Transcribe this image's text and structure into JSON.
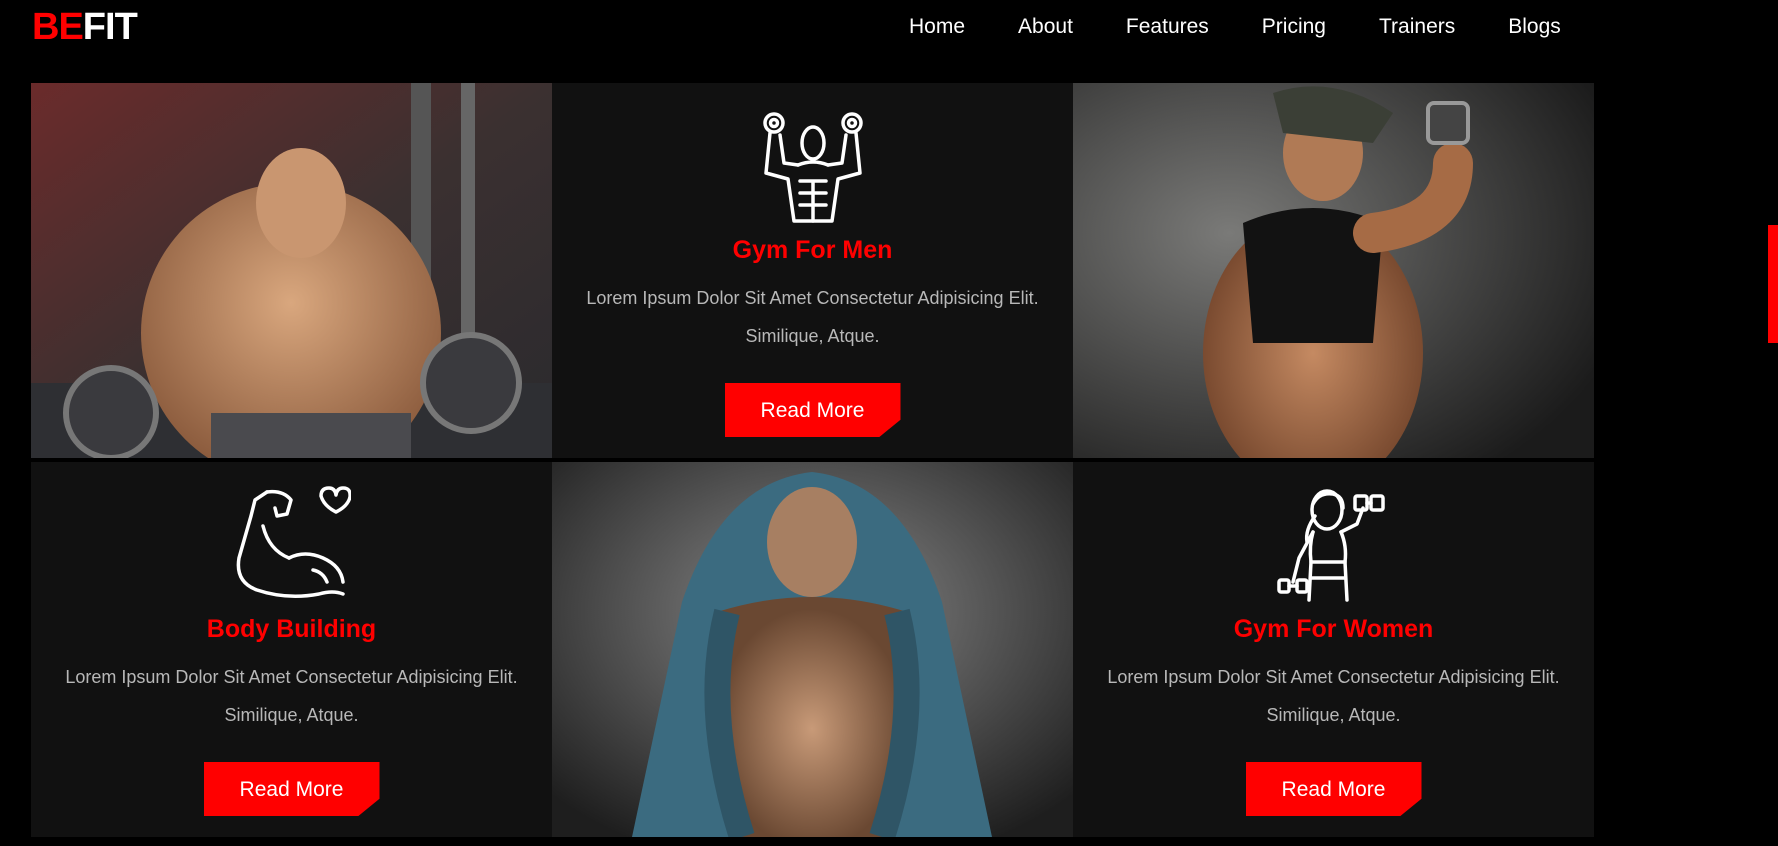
{
  "logo": {
    "part1": "BE",
    "part2": "FIT"
  },
  "nav": {
    "items": [
      {
        "label": "Home"
      },
      {
        "label": "About"
      },
      {
        "label": "Features"
      },
      {
        "label": "Pricing"
      },
      {
        "label": "Trainers"
      },
      {
        "label": "Blogs"
      }
    ]
  },
  "cards": {
    "gym_men": {
      "icon": "bodybuilder-dumbbells-icon",
      "title": "Gym For Men",
      "description": "Lorem Ipsum Dolor Sit Amet Consectetur Adipisicing Elit. Similique, Atque.",
      "button": "Read More"
    },
    "body_building": {
      "icon": "flexed-bicep-heart-icon",
      "title": "Body Building",
      "description": "Lorem Ipsum Dolor Sit Amet Consectetur Adipisicing Elit. Similique, Atque.",
      "button": "Read More"
    },
    "gym_women": {
      "icon": "woman-dumbbell-icon",
      "title": "Gym For Women",
      "description": "Lorem Ipsum Dolor Sit Amet Consectetur Adipisicing Elit. Similique, Atque.",
      "button": "Read More"
    }
  },
  "colors": {
    "accent": "#ff0000",
    "background": "#000000",
    "card_background": "#111111",
    "text_muted": "#b8b8b8"
  }
}
